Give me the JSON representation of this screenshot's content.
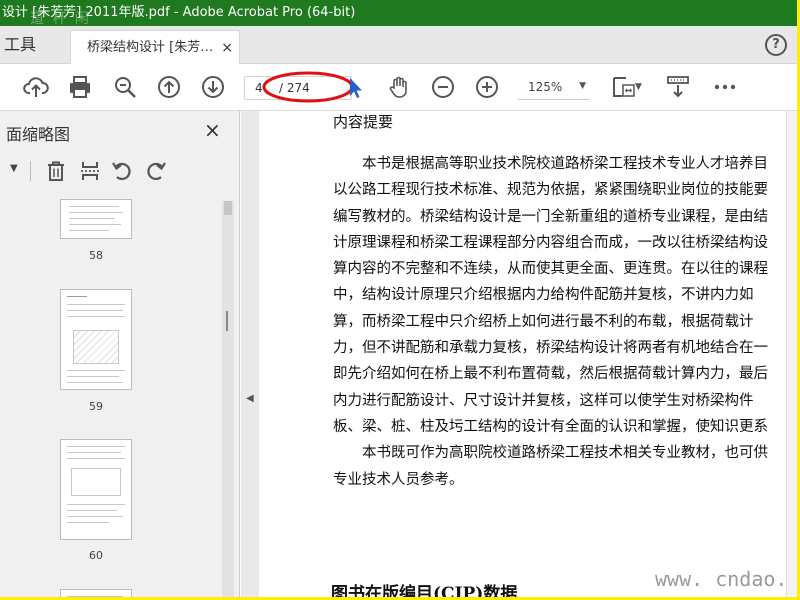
{
  "window": {
    "title": "设计 [朱芳芳] 2011年版.pdf - Adobe Acrobat Pro (64-bit)",
    "watermark": "道 杯 闲"
  },
  "tabs": {
    "tools_label": "工具",
    "doc_tab_label": "桥梁结构设计 [朱芳…",
    "close_symbol": "×",
    "help_symbol": "?"
  },
  "toolbar": {
    "page_current": "4",
    "page_total": "/ 274",
    "zoom": "125%"
  },
  "panel": {
    "title": "页面缩略图",
    "title_visible": "面缩略图",
    "close_symbol": "×",
    "thumbnails": [
      {
        "page": "58"
      },
      {
        "page": "59"
      },
      {
        "page": "60"
      }
    ]
  },
  "document": {
    "heading": "内容提要",
    "lines": [
      "本书是根据高等职业技术院校道路桥梁工程技术专业人才培养目",
      "以公路工程现行技术标准、规范为依据，紧紧围绕职业岗位的技能要",
      "编写教材的。桥梁结构设计是一门全新重组的道桥专业课程，是由结",
      "计原理课程和桥梁工程课程部分内容组合而成，一改以往桥梁结构设",
      "算内容的不完整和不连续，从而使其更全面、更连贯。在以往的课程",
      "中，结构设计原理只介绍根据内力给构件配筋并复核，不讲内力如",
      "算，而桥梁工程中只介绍桥上如何进行最不利的布载，根据荷载计",
      "力，但不讲配筋和承载力复核，桥梁结构设计将两者有机地结合在一",
      "即先介绍如何在桥上最不利布置荷载，然后根据荷载计算内力，最后",
      "内力进行配筋设计、尺寸设计并复核，这样可以使学生对桥梁构件",
      "板、梁、桩、柱及圬工结构的设计有全面的认识和掌握，使知识更系",
      "本书既可作为高职院校道路桥梁工程技术相关专业教材，也可供",
      "专业技术人员参考。"
    ],
    "cip_heading": "图书在版编目(CIP)数据",
    "site_watermark": "www. cndao. com"
  },
  "colors": {
    "titlebar": "#1f7a1f",
    "annotation_red": "#e01010",
    "frame_yellow": "#ffee00",
    "cursor_blue": "#2a5fc8"
  }
}
